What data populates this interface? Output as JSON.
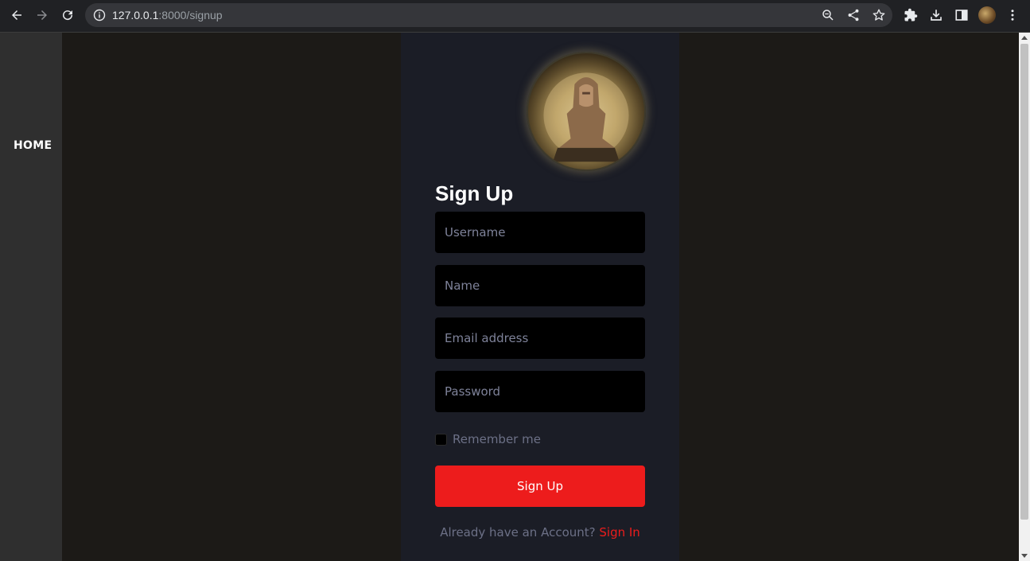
{
  "browser": {
    "url_host": "127.0.0.1",
    "url_path": ":8000/signup",
    "icons": [
      "back-icon",
      "forward-icon",
      "reload-icon",
      "info-icon",
      "zoom-icon",
      "share-icon",
      "star-icon",
      "extensions-icon",
      "download-icon",
      "side-panel-icon",
      "profile-avatar",
      "menu-icon"
    ]
  },
  "sidebar": {
    "home_label": "HOME"
  },
  "form": {
    "title": "Sign Up",
    "username_placeholder": "Username",
    "name_placeholder": "Name",
    "email_placeholder": "Email address",
    "password_placeholder": "Password",
    "remember_label": "Remember me",
    "submit_label": "Sign Up",
    "account_prompt": "Already have an Account?",
    "signin_label": "Sign In"
  },
  "colors": {
    "accent": "#ed1c1c",
    "card_bg": "#1b1d26",
    "page_bg": "#1c1a17",
    "sidebar_bg": "#2f2f2f"
  }
}
